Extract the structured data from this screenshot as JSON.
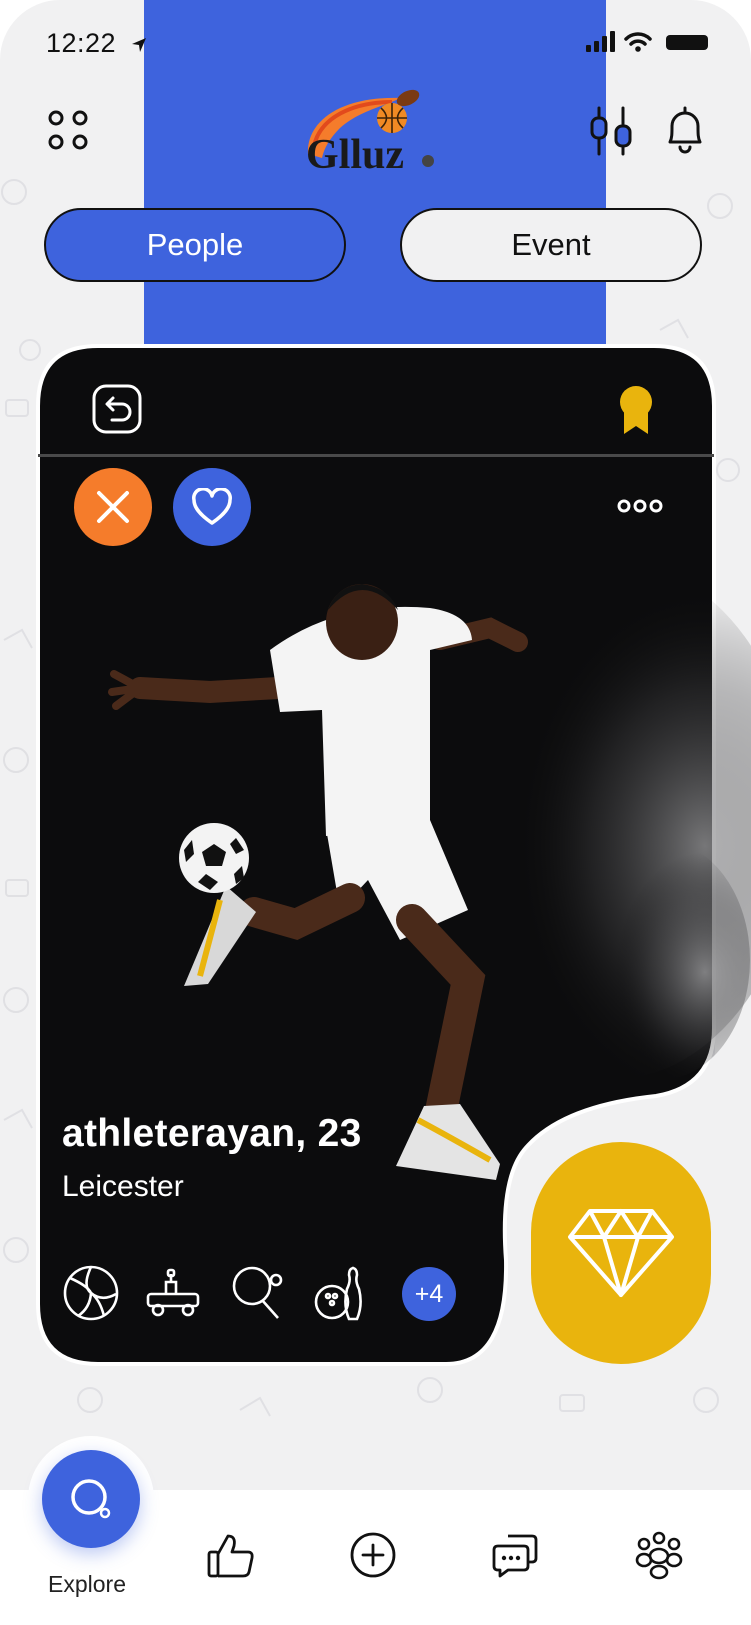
{
  "status_bar": {
    "time": "12:22"
  },
  "header": {
    "logo_text": "Glluz",
    "menu_icon": "grid-dots-icon",
    "filter_icon": "sliders-icon",
    "notification_icon": "bell-icon"
  },
  "tabs": [
    {
      "label": "People",
      "active": true
    },
    {
      "label": "Event",
      "active": false
    }
  ],
  "profile": {
    "name_age": "athleterayan, 23",
    "city": "Leicester",
    "sports": [
      "volleyball-icon",
      "kart-icon",
      "table-tennis-icon",
      "bowling-icon"
    ],
    "more_sports": "+4"
  },
  "actions": {
    "undo_icon": "undo-icon",
    "badge_icon": "award-ribbon-icon",
    "reject_icon": "close-icon",
    "like_icon": "heart-icon",
    "more_icon": "more-dots-icon",
    "premium_icon": "diamond-icon"
  },
  "bottom_nav": {
    "active_label": "Explore",
    "items": [
      "explore-icon",
      "thumbs-up-icon",
      "add-circle-icon",
      "chat-icon",
      "groups-icon"
    ]
  },
  "colors": {
    "brand_blue": "#3e63dd",
    "reject_orange": "#f57c2b",
    "premium_gold": "#e9b40d",
    "card_black": "#0c0c0d",
    "background": "#f1f1f2"
  }
}
